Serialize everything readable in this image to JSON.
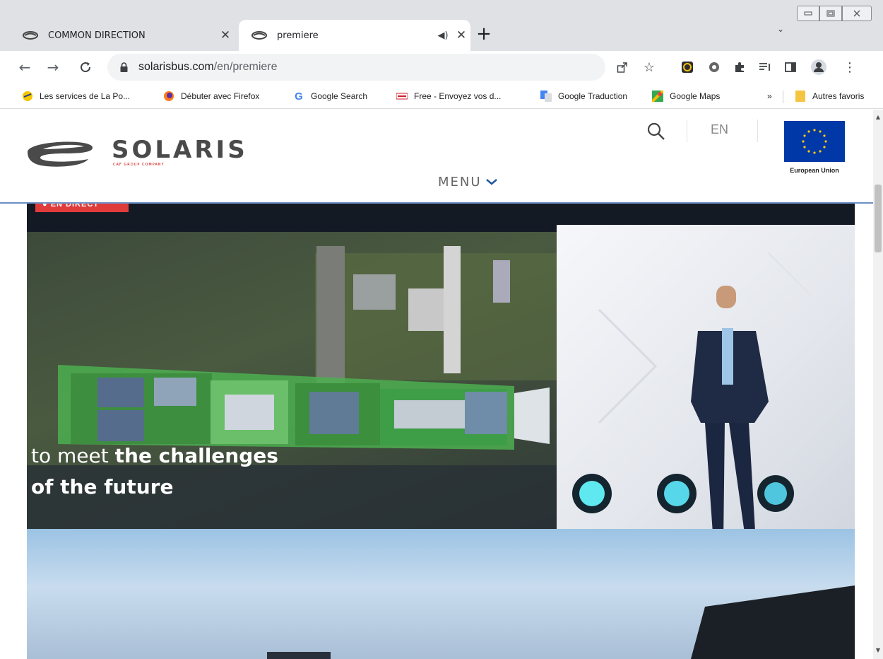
{
  "browser": {
    "tabs": [
      {
        "title": "COMMON DIRECTION",
        "icon": "solaris-favicon",
        "close_glyph": "✕"
      },
      {
        "title": "premiere",
        "icon": "solaris-favicon",
        "audio_glyph": "◀)",
        "close_glyph": "✕"
      }
    ],
    "new_tab_glyph": "+",
    "tab_search_glyph": "⌄",
    "address": {
      "host": "solarisbus.com",
      "path": "/en/premiere"
    },
    "bookmarks": [
      {
        "label": "Les services de La Po...",
        "icon": "laposte-icon"
      },
      {
        "label": "Débuter avec Firefox",
        "icon": "firefox-icon"
      },
      {
        "label": "Google Search",
        "icon": "google-icon"
      },
      {
        "label": "Free - Envoyez vos d...",
        "icon": "free-icon"
      },
      {
        "label": "Google Traduction",
        "icon": "translate-icon"
      },
      {
        "label": "Google Maps",
        "icon": "maps-icon"
      }
    ],
    "bookmarks_more_glyph": "»",
    "bookmarks_folder": "Autres favoris"
  },
  "site": {
    "logo_text": "SOLARIS",
    "logo_sub": "CAF GROUP COMPANY",
    "menu_label": "MENU",
    "menu_chevron": "⌄",
    "lang": "EN",
    "eu_label": "European Union"
  },
  "hero": {
    "badge": "● EN DIRECT",
    "line1_light": "to meet ",
    "line1_bold": "the challenges",
    "line2": "of the future"
  },
  "colors": {
    "accent": "#1e56a0",
    "eu_blue": "#0038a8",
    "eu_star": "#ffcc00",
    "live_red": "#e03b3b"
  }
}
